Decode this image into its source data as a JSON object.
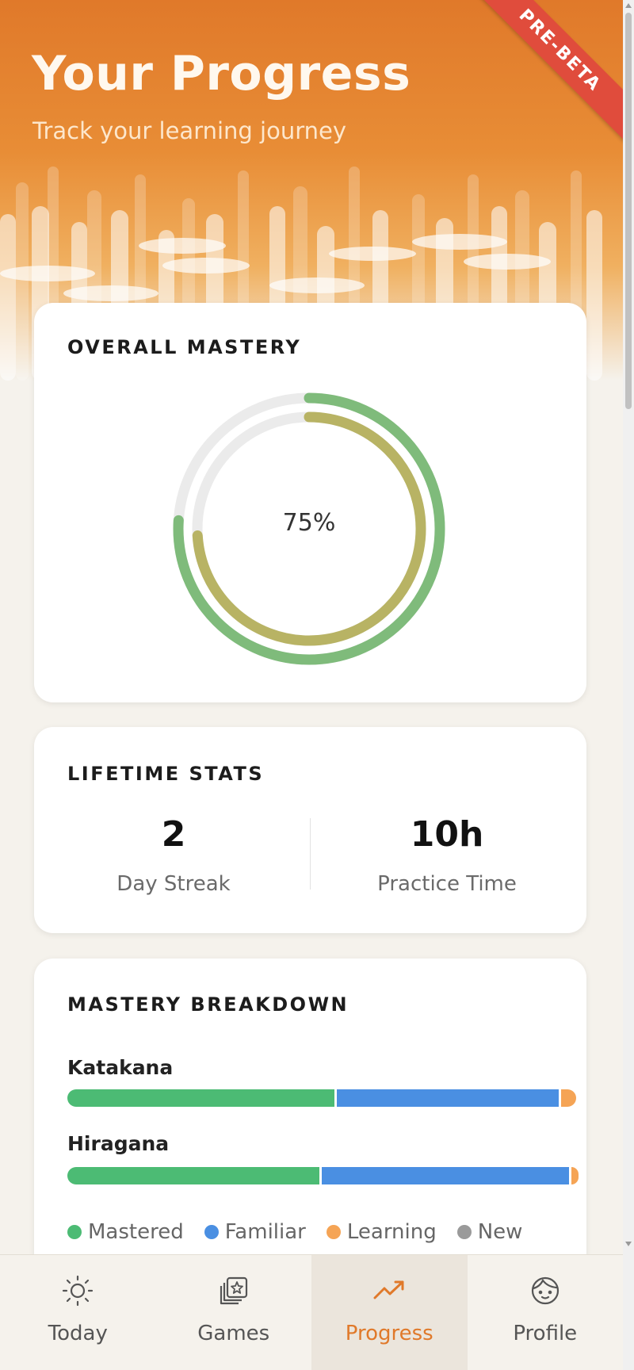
{
  "header": {
    "title": "Your Progress",
    "subtitle": "Track your learning journey",
    "ribbon": "PRE-BETA"
  },
  "overall_mastery": {
    "title": "OVERALL MASTERY",
    "percent_label": "75%",
    "outer_ring_fraction": 0.76,
    "inner_ring_fraction": 0.74,
    "colors": {
      "outer": "#7fbb7b",
      "inner": "#b8b364",
      "track": "#ebebeb"
    }
  },
  "lifetime_stats": {
    "title": "LIFETIME STATS",
    "items": [
      {
        "value": "2",
        "label": "Day Streak"
      },
      {
        "value": "10h",
        "label": "Practice Time"
      }
    ]
  },
  "mastery_breakdown": {
    "title": "MASTERY BREAKDOWN",
    "scripts": [
      {
        "name": "Katakana",
        "mastered": 0.52,
        "familiar": 0.43,
        "learning": 0.03,
        "new": 0.0
      },
      {
        "name": "Hiragana",
        "mastered": 0.49,
        "familiar": 0.48,
        "learning": 0.015,
        "new": 0.0
      }
    ],
    "legend": [
      {
        "label": "Mastered",
        "color": "#4cbb74"
      },
      {
        "label": "Familiar",
        "color": "#4a8fe2"
      },
      {
        "label": "Learning",
        "color": "#f5a455"
      },
      {
        "label": "New",
        "color": "#9a9a9a"
      }
    ]
  },
  "nav": {
    "items": [
      {
        "label": "Today",
        "icon": "sun-icon",
        "active": false
      },
      {
        "label": "Games",
        "icon": "cards-star-icon",
        "active": false
      },
      {
        "label": "Progress",
        "icon": "trend-up-icon",
        "active": true
      },
      {
        "label": "Profile",
        "icon": "face-icon",
        "active": false
      }
    ],
    "active_color": "#e0792a"
  }
}
